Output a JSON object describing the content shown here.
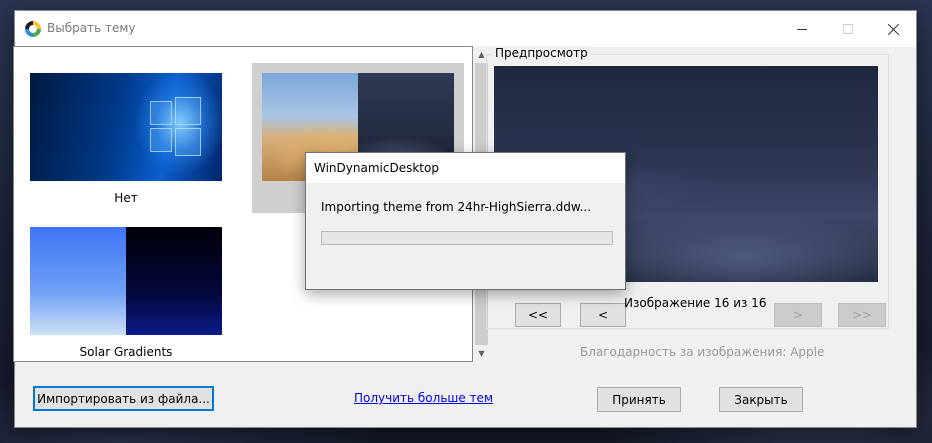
{
  "window": {
    "title": "Выбрать тему"
  },
  "themes": [
    {
      "name": "Нет"
    },
    {
      "name": ""
    },
    {
      "name": "Solar Gradients"
    }
  ],
  "preview": {
    "legend": "Предпросмотр",
    "first_label": "<<",
    "prev_label": "<",
    "next_label": ">",
    "last_label": ">>",
    "counter": "Изображение 16 из  16",
    "credit": "Благодарность за изображения: Apple"
  },
  "footer": {
    "import_label": "Импортировать из файла...",
    "more_themes_link": "Получить больше тем",
    "apply_label": "Принять",
    "close_label": "Закрыть"
  },
  "dialog": {
    "title": "WinDynamicDesktop",
    "message": "Importing theme from 24hr-HighSierra.ddw...",
    "progress": 0
  },
  "colors": {
    "accent": "#0078d7",
    "link": "#0000ee",
    "selection": "#cfcfcf"
  }
}
